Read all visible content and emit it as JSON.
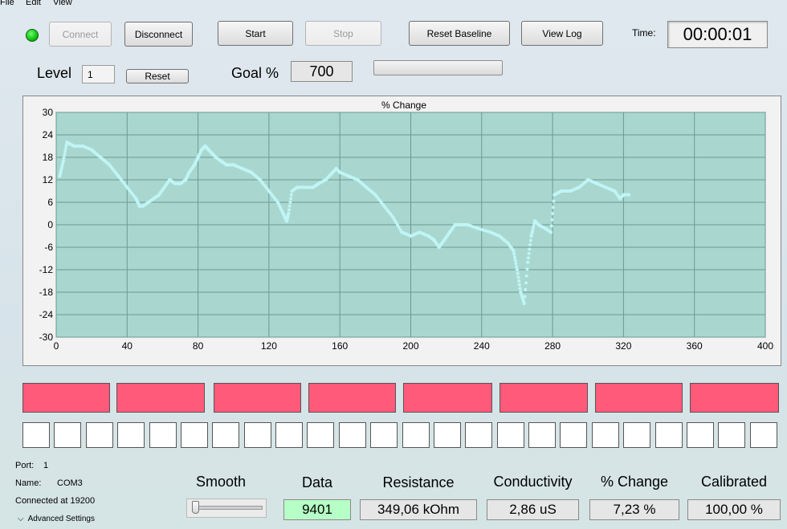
{
  "menu": {
    "file": "File",
    "edit": "Edit",
    "view": "View"
  },
  "toolbar": {
    "connect": "Connect",
    "disconnect": "Disconnect",
    "start": "Start",
    "stop": "Stop",
    "reset_baseline": "Reset Baseline",
    "view_log": "View Log",
    "time_label": "Time:",
    "time_value": "00:00:01"
  },
  "level": {
    "label": "Level",
    "value": "1",
    "reset": "Reset"
  },
  "goal": {
    "label": "Goal %",
    "value": "700"
  },
  "colors": {
    "led": "#1fd51f",
    "plot_bg": "#aad6d0",
    "trace": "#c0f5f5",
    "block": "#ff5a7a"
  },
  "chart_data": {
    "type": "scatter",
    "title": "% Change",
    "xlim": [
      0,
      400
    ],
    "ylim": [
      -30,
      30
    ],
    "xticks": [
      0,
      40,
      80,
      120,
      160,
      200,
      240,
      280,
      320,
      360,
      400
    ],
    "yticks": [
      30,
      24,
      18,
      12,
      6,
      0,
      -6,
      -12,
      -18,
      -24,
      -30
    ],
    "grid": true,
    "series": [
      {
        "x": [
          2,
          4,
          6,
          10,
          15,
          20,
          25,
          30,
          35,
          40,
          45,
          47,
          49,
          52,
          55,
          58,
          61,
          64,
          67,
          70,
          73,
          75,
          78,
          80,
          82,
          84,
          86,
          88,
          90,
          93,
          96,
          100,
          105,
          110,
          115,
          120,
          125,
          128,
          130,
          131,
          133,
          136,
          140,
          145,
          148,
          152,
          156,
          158,
          160,
          165,
          170,
          175,
          180,
          185,
          190,
          195,
          200,
          205,
          210,
          213,
          216,
          219,
          222,
          225,
          228,
          232,
          238,
          245,
          250,
          255,
          258,
          260,
          262,
          264,
          266,
          268,
          270,
          272,
          276,
          279,
          281,
          285,
          290,
          295,
          300,
          305,
          310,
          315,
          318,
          320,
          323
        ],
        "y": [
          13,
          17,
          22,
          21,
          21,
          20,
          18,
          16,
          13,
          10,
          7,
          5,
          5,
          6,
          7,
          8,
          10,
          12,
          11,
          11,
          12,
          14,
          16,
          18,
          20,
          21,
          20,
          19,
          18,
          17,
          16,
          16,
          15,
          14,
          12,
          9,
          6,
          3,
          1,
          3,
          9,
          10,
          10,
          10,
          11,
          12,
          14,
          15,
          14,
          13,
          12,
          10,
          8,
          5,
          2,
          -2,
          -3,
          -2,
          -3,
          -4,
          -6,
          -4,
          -2,
          0,
          0,
          0,
          -1,
          -2,
          -3,
          -5,
          -7,
          -12,
          -18,
          -21,
          -10,
          -3,
          1,
          0,
          -1,
          -2,
          8,
          9,
          9,
          10,
          12,
          11,
          10,
          9,
          7,
          8,
          8
        ]
      }
    ]
  },
  "blocks": {
    "count": 8,
    "cells": 24
  },
  "port": {
    "port_label": "Port:",
    "port_value": "1",
    "name_label": "Name:",
    "name_value": "COM3",
    "connected": "Connected at 19200",
    "advanced": "Advanced Settings"
  },
  "meters": {
    "smooth_label": "Smooth",
    "smooth_level": 0,
    "data_label": "Data",
    "data_value": "9401",
    "resistance_label": "Resistance",
    "resistance_value": "349,06 kOhm",
    "conductivity_label": "Conductivity",
    "conductivity_value": "2,86 uS",
    "pchange_label": "% Change",
    "pchange_value": "7,23 %",
    "calibrated_label": "Calibrated",
    "calibrated_value": "100,00 %"
  }
}
